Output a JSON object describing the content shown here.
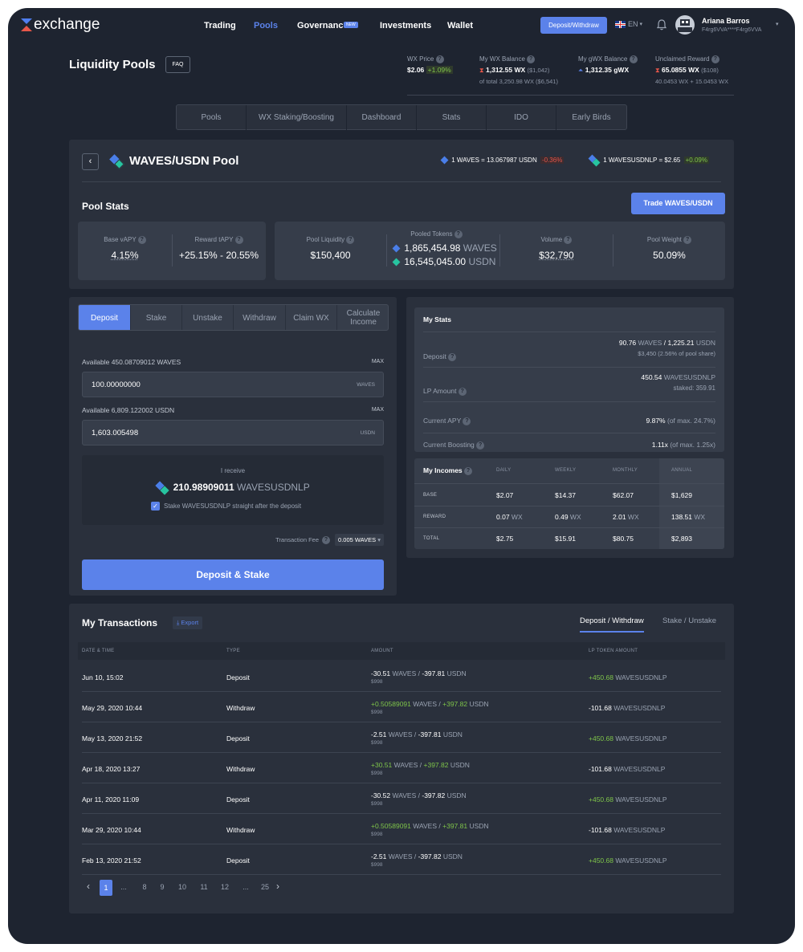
{
  "nav": {
    "logo": "exchange",
    "links": [
      "Trading",
      "Pools",
      "Governance",
      "Investments",
      "Wallet"
    ],
    "new_badge": "NEW",
    "deposit_withdraw": "Deposit/Withdraw",
    "lang": "EN",
    "user_name": "Ariana Barros",
    "user_addr": "F4rg6VVA****F4rg6VVA"
  },
  "header": {
    "title": "Liquidity Pools",
    "faq": "FAQ",
    "wx_price_label": "WX Price",
    "wx_price": "$2.06",
    "wx_change": "+1.09%",
    "my_wx_label": "My WX Balance",
    "my_wx": "1,312.55 WX",
    "my_wx_usd": "($1,042)",
    "my_wx_total": "of total 3,250.98 WX ($6,541)",
    "gwx_label": "My gWX Balance",
    "gwx": "1,312.35 gWX",
    "unclaimed_label": "Unclaimed Reward",
    "unclaimed": "65.0855 WX",
    "unclaimed_usd": "($108)",
    "unclaimed_sub": "40.0453 WX + 15.0453 WX"
  },
  "tabs": [
    "Pools",
    "WX Staking/Boosting",
    "Dashboard",
    "Stats",
    "IDO",
    "Early Birds"
  ],
  "pool": {
    "title": "WAVES/USDN Pool",
    "rate1": "1 WAVES = 13.067987 USDN",
    "rate1_change": "-0.36%",
    "rate2": "1 WAVESUSDNLP = $2.65",
    "rate2_change": "+0.09%",
    "stats_title": "Pool Stats",
    "trade_btn": "Trade WAVES/USDN",
    "base_vapy_label": "Base vAPY",
    "base_vapy": "4.15%",
    "reward_tapy_label": "Reward tAPY",
    "reward_tapy": "+25.15% - 20.55%",
    "liquidity_label": "Pool Liquidity",
    "liquidity": "$150,400",
    "pooled_label": "Pooled Tokens",
    "pooled_waves_amt": "1,865,454.98",
    "pooled_waves_sym": "WAVES",
    "pooled_usdn_amt": "16,545,045.00",
    "pooled_usdn_sym": "USDN",
    "volume_label": "Volume",
    "volume": "$32,790",
    "weight_label": "Pool Weight",
    "weight": "50.09%"
  },
  "deposit": {
    "tabs": [
      "Deposit",
      "Stake",
      "Unstake",
      "Withdraw",
      "Claim WX",
      "Calculate Income"
    ],
    "avail_waves": "Available 450.08709012 WAVES",
    "max": "MAX",
    "waves_value": "100.00000000",
    "waves_sym": "WAVES",
    "avail_usdn": "Available 6,809.122002 USDN",
    "usdn_value": "1,603.005498",
    "usdn_sym": "USDN",
    "receive_label": "I receive",
    "receive_amt": "210.98909011",
    "receive_sym": "WAVESUSDNLP",
    "stake_check": "Stake WAVESUSDNLP straight after the deposit",
    "fee_label": "Transaction Fee",
    "fee_value": "0.005 WAVES",
    "submit": "Deposit & Stake"
  },
  "mystats": {
    "title": "My Stats",
    "deposit_label": "Deposit",
    "deposit_waves": "90.76",
    "deposit_waves_sym": "WAVES",
    "deposit_sep": "/",
    "deposit_usdn": "1,225.21",
    "deposit_usdn_sym": "USDN",
    "deposit_sub": "$3,450 (2.56% of pool share)",
    "lp_label": "LP Amount",
    "lp_amt": "450.54",
    "lp_sym": "WAVESUSDNLP",
    "lp_staked": "staked: 359.91",
    "apy_label": "Current APY",
    "apy": "9.87%",
    "apy_max": "(of max. 24.7%)",
    "boost_label": "Current Boosting",
    "boost": "1.11x",
    "boost_max": "(of max. 1.25x)"
  },
  "incomes": {
    "title": "My Incomes",
    "cols": [
      "DAILY",
      "WEEKLY",
      "MONTHLY",
      "ANNUAL"
    ],
    "rows": [
      {
        "label": "BASE",
        "v": [
          "$2.07",
          "$14.37",
          "$62.07",
          "$1,629"
        ],
        "u": [
          "",
          "",
          "",
          ""
        ]
      },
      {
        "label": "REWARD",
        "v": [
          "0.07",
          "0.49",
          "2.01",
          "138.51"
        ],
        "u": [
          "WX",
          "WX",
          "WX",
          "WX"
        ]
      },
      {
        "label": "TOTAL",
        "v": [
          "$2.75",
          "$15.91",
          "$80.75",
          "$2,893"
        ],
        "u": [
          "",
          "",
          "",
          ""
        ]
      }
    ]
  },
  "transactions": {
    "title": "My Transactions",
    "export": "Export",
    "tab1": "Deposit / Withdraw",
    "tab2": "Stake / Unstake",
    "headers": [
      "DATE & TIME",
      "TYPE",
      "AMOUNT",
      "LP TOKEN AMOUNT"
    ],
    "rows": [
      {
        "date": "Jun 10, 15:02",
        "type": "Deposit",
        "a1": "-30.51",
        "a2": "-397.81",
        "usd": "$998",
        "lp": "+450.68",
        "pos": false
      },
      {
        "date": "May 29, 2020 10:44",
        "type": "Withdraw",
        "a1": "+0.50589091",
        "a2": "+397.82",
        "usd": "$998",
        "lp": "-101.68",
        "pos": true
      },
      {
        "date": "May 13, 2020 21:52",
        "type": "Deposit",
        "a1": "-2.51",
        "a2": "-397.81",
        "usd": "$998",
        "lp": "+450.68",
        "pos": false
      },
      {
        "date": "Apr 18, 2020 13:27",
        "type": "Withdraw",
        "a1": "+30.51",
        "a2": "+397.82",
        "usd": "$998",
        "lp": "-101.68",
        "pos": true
      },
      {
        "date": "Apr 11, 2020 11:09",
        "type": "Deposit",
        "a1": "-30.52",
        "a2": "-397.82",
        "usd": "$998",
        "lp": "+450.68",
        "pos": false
      },
      {
        "date": "Mar 29, 2020 10:44",
        "type": "Withdraw",
        "a1": "+0.50589091",
        "a2": "+397.81",
        "usd": "$998",
        "lp": "-101.68",
        "pos": true
      },
      {
        "date": "Feb 13, 2020 21:52",
        "type": "Deposit",
        "a1": "-2.51",
        "a2": "-397.82",
        "usd": "$998",
        "lp": "+450.68",
        "pos": false
      }
    ],
    "sym1": "WAVES",
    "sym2": "USDN",
    "lp_sym": "WAVESUSDNLP",
    "sep": "/",
    "pages": [
      "1",
      "...",
      "8",
      "9",
      "10",
      "11",
      "12",
      "...",
      "25"
    ]
  }
}
